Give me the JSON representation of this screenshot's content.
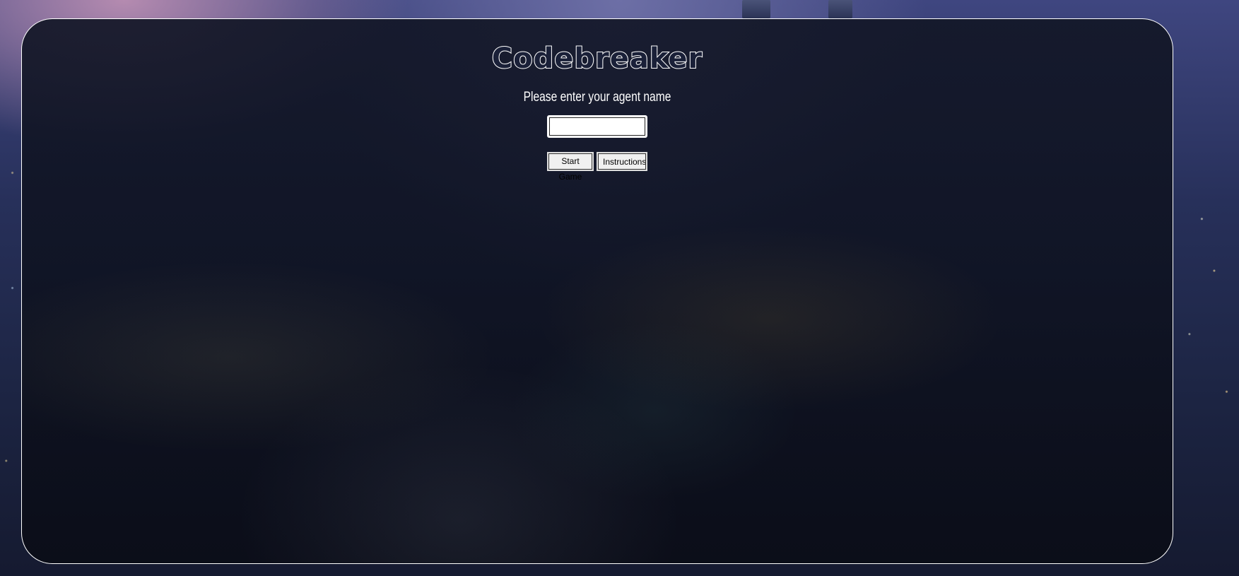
{
  "app": {
    "title": "Codebreaker",
    "prompt": "Please enter your agent name"
  },
  "form": {
    "agent_name_value": "",
    "agent_name_placeholder": ""
  },
  "actions": {
    "start_label": "Start Game",
    "instructions_label": "Instructions"
  },
  "colors": {
    "panel_border": "#ffffff",
    "panel_background": "#121626",
    "text": "#ffffff",
    "button_background": "#f0f0f0"
  }
}
